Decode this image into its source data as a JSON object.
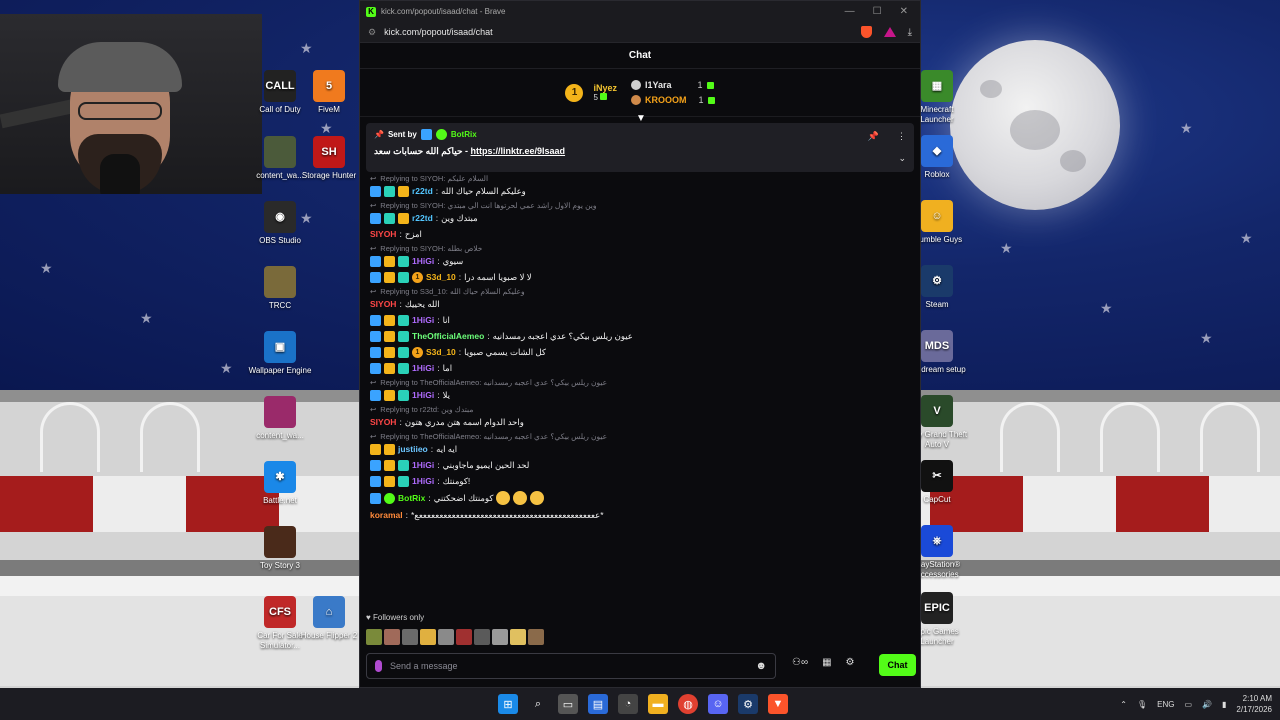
{
  "browser": {
    "title": "kick.com/popout/isaad/chat - Brave",
    "url": "kick.com/popout/isaad/chat"
  },
  "chat": {
    "header": "Chat",
    "leaderboard": {
      "first": {
        "name": "iNyez",
        "count": "5",
        "rank": "1"
      },
      "others": [
        {
          "name": "I1Yara",
          "count": "1"
        },
        {
          "name": "KROOOM",
          "count": "1"
        }
      ]
    },
    "pinned": {
      "sent_by": "Sent by",
      "bot": "BotRix",
      "text": "حياكم الله حسابات سعد - ",
      "link": "https://linktr.ee/9Isaad"
    },
    "messages": [
      {
        "reply": "Replying to SIYOH: السلام عليكم",
        "user": "r22td",
        "user_color": "#53c6ff",
        "text": "وعليكم السلام حياك الله",
        "badges": [
          "mod",
          "vip",
          "sub"
        ]
      },
      {
        "reply": "Replying to SIYOH: وين يوم الاول راشد عمي لحرتوها انت الي مبتدي",
        "user": "r22td",
        "user_color": "#53c6ff",
        "text": "مبتدك وين",
        "badges": [
          "mod",
          "vip",
          "sub"
        ]
      },
      {
        "reply": "",
        "user": "SIYOH",
        "user_color": "#ff4747",
        "text": "امزح",
        "badges": []
      },
      {
        "reply": "Replying to SIYOH: خلاص بطله",
        "user": "1HiGi",
        "user_color": "#b06cff",
        "text": "سيوي",
        "badges": [
          "mod",
          "sub",
          "vip"
        ]
      },
      {
        "reply": "",
        "user": "S3d_10",
        "user_color": "#f4b41a",
        "text": "لا لا صبويا اسمه درا",
        "badges": [
          "mod",
          "sub",
          "vip",
          "one"
        ]
      },
      {
        "reply": "Replying to S3d_10: وعليكم السلام حياك الله",
        "user": "SIYOH",
        "user_color": "#ff4747",
        "text": "الله يحييك",
        "badges": []
      },
      {
        "reply": "",
        "user": "1HiGi",
        "user_color": "#b06cff",
        "text": "انا",
        "badges": [
          "mod",
          "sub",
          "vip"
        ]
      },
      {
        "reply": "",
        "user": "TheOfficialAemeo",
        "user_color": "#6cff7a",
        "text": "عيون ريلس بيكي؟ عدي اعجبه رمسدانيه",
        "badges": [
          "mod",
          "sub",
          "vip"
        ]
      },
      {
        "reply": "",
        "user": "S3d_10",
        "user_color": "#f4b41a",
        "text": "كل الشات يسمي صبويا",
        "badges": [
          "mod",
          "sub",
          "vip",
          "one"
        ]
      },
      {
        "reply": "",
        "user": "1HiGi",
        "user_color": "#b06cff",
        "text": "اما",
        "badges": [
          "mod",
          "sub",
          "vip"
        ]
      },
      {
        "reply": "Replying to TheOfficialAemeo: عيون ريلس بيكي؟ عدي اعجبه رمسدانيه",
        "user": "1HiGi",
        "user_color": "#b06cff",
        "text": "يلا",
        "badges": [
          "mod",
          "sub",
          "vip"
        ]
      },
      {
        "reply": "Replying to r22td: مبتدك وين",
        "user": "SIYOH",
        "user_color": "#ff4747",
        "text": "واحد الدوام اسمه هتن مدري هتون",
        "badges": []
      },
      {
        "reply": "Replying to TheOfficialAemeo: عيون ريلس بيكي؟ عدي اعجبه رمسدانيه",
        "user": "justiieo",
        "user_color": "#6cc6ff",
        "text": "ايه ايه",
        "badges": [
          "sub",
          "gold"
        ]
      },
      {
        "reply": "",
        "user": "1HiGi",
        "user_color": "#b06cff",
        "text": "لحد الحين ايميو ماجاوبني",
        "badges": [
          "mod",
          "sub",
          "vip"
        ]
      },
      {
        "reply": "",
        "user": "1HiGi",
        "user_color": "#b06cff",
        "text": "كومنتك!",
        "badges": [
          "mod",
          "sub",
          "vip"
        ]
      },
      {
        "reply": "",
        "user": "BotRix",
        "user_color": "#53fc18",
        "text": "كومنتك اضحكتني",
        "badges": [
          "mod",
          "ver"
        ]
      },
      {
        "reply": "",
        "user": "koramal",
        "user_color": "#ff8a3a",
        "text": "*ععععععععععععععععععععععععععععععععععععععععععععع*",
        "badges": []
      }
    ],
    "followers_only": "Followers only",
    "composer_placeholder": "Send a message",
    "send_label": "Chat"
  },
  "desktop_icons_left": [
    {
      "label": "Call of Duty",
      "color": "#222222",
      "glyph": "CALL"
    },
    {
      "label": "FiveM",
      "color": "#f07a1e",
      "glyph": "5"
    },
    {
      "label": "content_wa...",
      "color": "#4b5a3a",
      "glyph": ""
    },
    {
      "label": "Storage Hunter",
      "color": "#c01818",
      "glyph": "SH"
    },
    {
      "label": "OBS Studio",
      "color": "#2a2a2a",
      "glyph": "◉"
    },
    {
      "label": "TRCC",
      "color": "#7a6a3a",
      "glyph": ""
    },
    {
      "label": "Wallpaper Engine",
      "color": "#1a72c8",
      "glyph": "▣"
    },
    {
      "label": "content_wa...",
      "color": "#9a2a6a",
      "glyph": ""
    },
    {
      "label": "Battle.net",
      "color": "#1a88e8",
      "glyph": "✱"
    },
    {
      "label": "Toy Story 3",
      "color": "#4a2a1a",
      "glyph": ""
    },
    {
      "label": "Car For Sale Simulator...",
      "color": "#c02828",
      "glyph": "CFS"
    },
    {
      "label": "House Flipper 2",
      "color": "#3a7ac8",
      "glyph": "⌂"
    }
  ],
  "desktop_icons_right": [
    {
      "label": "Minecraft Launcher",
      "color": "#3a8a2a",
      "glyph": "▦"
    },
    {
      "label": "Roblox",
      "color": "#2a6ad8",
      "glyph": "◆"
    },
    {
      "label": "Stumble Guys",
      "color": "#f0b020",
      "glyph": "☺"
    },
    {
      "label": "Steam",
      "color": "#1a3a6a",
      "glyph": "⚙"
    },
    {
      "label": "My dream setup",
      "color": "#6a6a9a",
      "glyph": "MDS"
    },
    {
      "label": "Play Grand Theft Auto V",
      "color": "#2a4a2a",
      "glyph": "V"
    },
    {
      "label": "CapCut",
      "color": "#111111",
      "glyph": "✂"
    },
    {
      "label": "PlayStation® Accessories",
      "color": "#1a4ad8",
      "glyph": "⎈"
    },
    {
      "label": "Epic Games Launcher",
      "color": "#222222",
      "glyph": "EPIC"
    }
  ],
  "taskbar": {
    "lang": "ENG",
    "time": "2:10 AM",
    "date": "2/17/2026"
  }
}
